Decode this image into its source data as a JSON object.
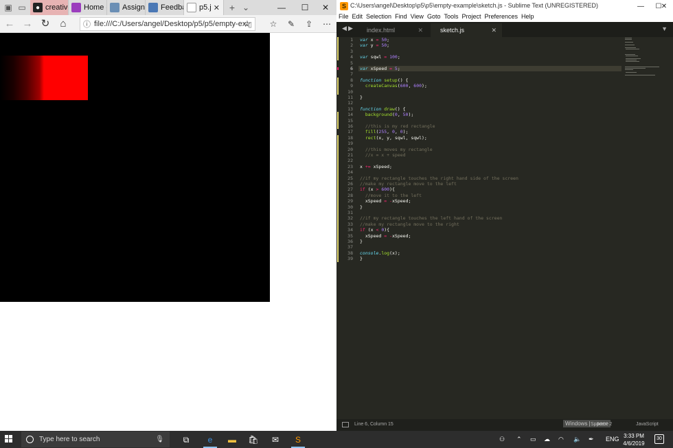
{
  "browser": {
    "tabs": [
      {
        "label": "creative",
        "favicon": "github-icon",
        "color": "#d7a1a1"
      },
      {
        "label": "Home -",
        "favicon": "onenote-icon",
        "color": "#9b3dbd"
      },
      {
        "label": "Assignn",
        "favicon": "assignment-icon",
        "color": "#6b8fb5"
      },
      {
        "label": "Feedba",
        "favicon": "feedback-icon",
        "color": "#4b78b5"
      },
      {
        "label": "p5.j",
        "favicon": "page-icon",
        "color": "#f2f2f2"
      }
    ],
    "address_url": "file:///C:/Users/angel/Desktop/p5/p5/empty-exam",
    "canvas": {
      "background": "#000000",
      "rect_color": "#ff0000"
    }
  },
  "sublime": {
    "window_title": "C:\\Users\\angel\\Desktop\\p5\\p5\\empty-example\\sketch.js - Sublime Text (UNREGISTERED)",
    "menu": [
      "File",
      "Edit",
      "Selection",
      "Find",
      "View",
      "Goto",
      "Tools",
      "Project",
      "Preferences",
      "Help"
    ],
    "tabs": [
      {
        "label": "index.html"
      },
      {
        "label": "sketch.js"
      }
    ],
    "active_line": 6,
    "status": {
      "position": "Line 6, Column 15",
      "spaces": "Spaces: 2",
      "syntax": "JavaScript"
    },
    "watermark": "Windows | ...pace"
  },
  "taskbar": {
    "search_placeholder": "Type here to search",
    "language": "ENG",
    "time": "3:33 PM",
    "date": "4/6/2019",
    "notifications": "30"
  }
}
